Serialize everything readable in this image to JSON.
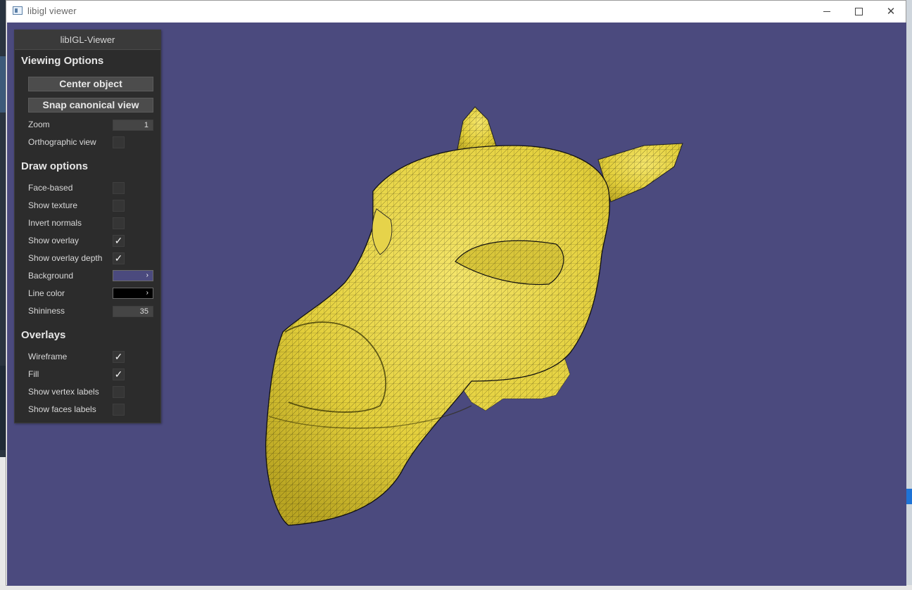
{
  "window": {
    "title": "libigl viewer",
    "background_color": "#4b4a7e",
    "controls": {
      "minimize": "minimize-icon",
      "maximize": "maximize-icon",
      "close": "close-icon",
      "close_glyph": "✕"
    }
  },
  "panel": {
    "title": "libIGL-Viewer",
    "viewing": {
      "header": "Viewing Options",
      "center_object": "Center object",
      "snap_view": "Snap canonical view",
      "zoom_label": "Zoom",
      "zoom_value": "1",
      "ortho_label": "Orthographic view",
      "ortho_checked": false
    },
    "draw": {
      "header": "Draw options",
      "face_based": "Face-based",
      "face_based_checked": false,
      "show_texture": "Show texture",
      "show_texture_checked": false,
      "invert_normals": "Invert normals",
      "invert_normals_checked": false,
      "show_overlay": "Show overlay",
      "show_overlay_checked": true,
      "show_overlay_depth": "Show overlay depth",
      "show_overlay_depth_checked": true,
      "background_label": "Background",
      "background_color": "#4b4a7e",
      "line_color_label": "Line color",
      "line_color": "#000000",
      "shininess_label": "Shininess",
      "shininess_value": "35",
      "arrow_glyph": "›"
    },
    "overlays": {
      "header": "Overlays",
      "wireframe": "Wireframe",
      "wireframe_checked": true,
      "fill": "Fill",
      "fill_checked": true,
      "vertex_labels": "Show vertex labels",
      "vertex_labels_checked": false,
      "faces_labels": "Show faces labels",
      "faces_labels_checked": false
    },
    "check_glyph": "✓"
  },
  "model": {
    "fill_color": "#e8d640",
    "wire_color": "#000000"
  }
}
